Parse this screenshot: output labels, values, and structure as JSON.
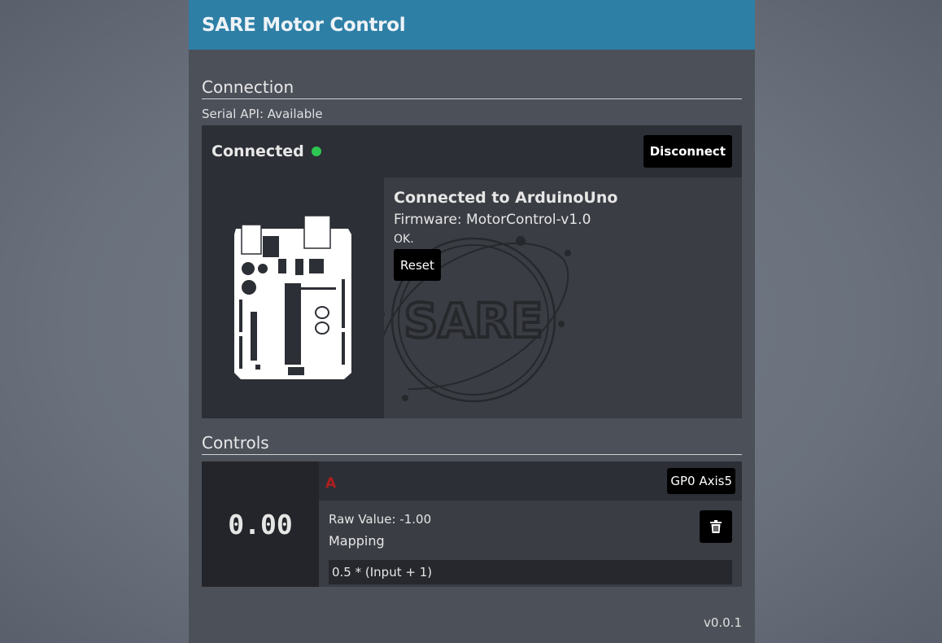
{
  "app": {
    "title": "SARE Motor Control",
    "version": "v0.0.1"
  },
  "connection": {
    "section_title": "Connection",
    "serial_api": "Serial API: Available",
    "status": "Connected",
    "status_color": "#2dc653",
    "disconnect_label": "Disconnect",
    "device_title": "Connected to ArduinoUno",
    "firmware": "Firmware: MotorControl-v1.0",
    "device_status": "OK.",
    "reset_label": "Reset",
    "logo_text": "SARE",
    "board_icon": "arduino-uno-board-icon"
  },
  "controls": {
    "section_title": "Controls",
    "items": [
      {
        "value_display": "0.00",
        "label": "A",
        "label_color": "#b01e1e",
        "input_source": "GP0 Axis5",
        "raw_value": "Raw Value: -1.00",
        "mapping_label": "Mapping",
        "mapping_expression": "0.5 * (Input + 1)",
        "delete_icon": "trash-icon"
      }
    ]
  },
  "colors": {
    "header": "#2e7fa6",
    "panel": "#3a3d44",
    "button": "#000000"
  }
}
